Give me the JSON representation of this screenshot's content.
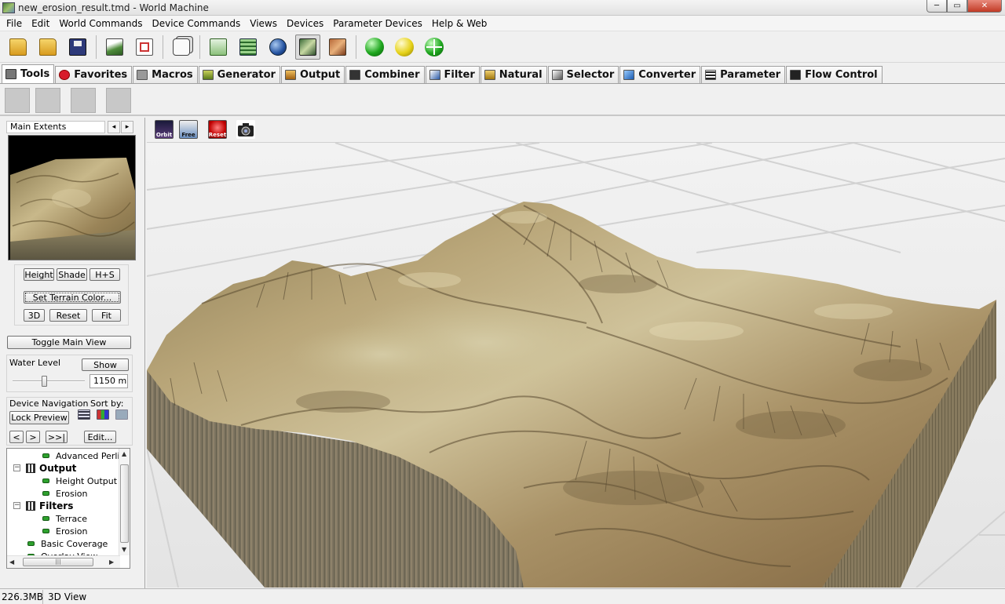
{
  "window": {
    "title": "new_erosion_result.tmd - World Machine"
  },
  "menu": [
    "File",
    "Edit",
    "World Commands",
    "Device Commands",
    "Views",
    "Devices",
    "Parameter Devices",
    "Help & Web"
  ],
  "toolbar": {
    "icons": [
      "new-project-icon",
      "open-folder-icon",
      "save-disk-icon",
      "terrain-icon",
      "document-icon",
      "random-seed-icon",
      "device-network-icon",
      "layout-grid-icon",
      "world-view-icon",
      "3d-view-icon",
      "texture-view-icon",
      "build-green-icon",
      "build-yellow-icon",
      "build-region-icon"
    ]
  },
  "device_tabs": [
    {
      "label": "Tools",
      "color": "#444444"
    },
    {
      "label": "Favorites",
      "color": "#d81b2a"
    },
    {
      "label": "Macros",
      "color": "#555555"
    },
    {
      "label": "Generator",
      "color": "#7a8a2a"
    },
    {
      "label": "Output",
      "color": "#b87a2a"
    },
    {
      "label": "Combiner",
      "color": "#333333"
    },
    {
      "label": "Filter",
      "color": "#2a5aa8"
    },
    {
      "label": "Natural",
      "color": "#c8a030"
    },
    {
      "label": "Selector",
      "color": "#4a4a4a"
    },
    {
      "label": "Converter",
      "color": "#3a7ac8"
    },
    {
      "label": "Parameter",
      "color": "#222222"
    },
    {
      "label": "Flow Control",
      "color": "#222222"
    }
  ],
  "left_panel": {
    "extents_label": "Main Extents",
    "prev_arrow": "◂",
    "next_arrow": "▸",
    "view_modes": [
      "Height",
      "Shade",
      "H+S"
    ],
    "set_terrain_color": "Set Terrain Color...",
    "btn_3d": "3D",
    "btn_reset": "Reset",
    "btn_fit": "Fit",
    "toggle_main_view": "Toggle Main View",
    "water_level_label": "Water Level",
    "water_show": "Show",
    "water_level_value": "1150 m",
    "water_level_fraction": 0.43,
    "device_nav_label": "Device Navigation",
    "sort_by_label": "Sort by:",
    "lock_preview": "Lock Preview",
    "nav_back": "<",
    "nav_forward": ">",
    "nav_end": ">>|",
    "edit": "Edit...",
    "tree": [
      {
        "label": "Advanced Perlin",
        "kind": "device"
      },
      {
        "label": "Output",
        "kind": "group",
        "expander": "⊟"
      },
      {
        "label": "Height Output",
        "kind": "device"
      },
      {
        "label": "Erosion",
        "kind": "device"
      },
      {
        "label": "Filters",
        "kind": "group",
        "expander": "⊟"
      },
      {
        "label": "Terrace",
        "kind": "device"
      },
      {
        "label": "Erosion",
        "kind": "device"
      },
      {
        "label": "Basic Coverage",
        "kind": "device"
      },
      {
        "label": "Overlay View",
        "kind": "device"
      }
    ]
  },
  "view_toolbar": {
    "orbit": "Orbit",
    "free": "Free",
    "reset": "Reset"
  },
  "status": {
    "memory": "226.3MB",
    "view": "3D View"
  }
}
